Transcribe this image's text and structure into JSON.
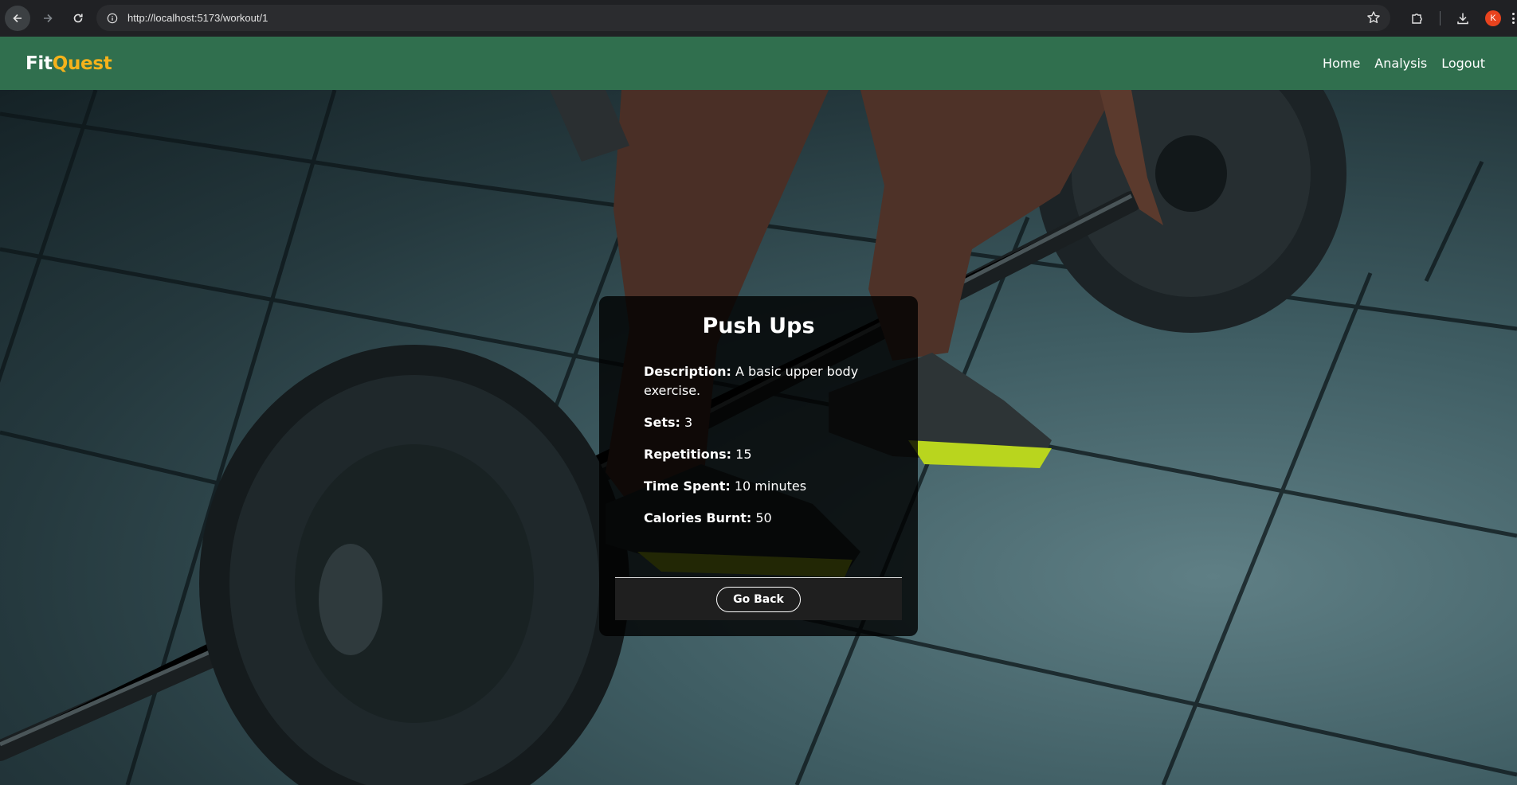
{
  "browser": {
    "url": "http://localhost:5173/workout/1",
    "profile_initial": "K"
  },
  "app": {
    "logo_fit": "Fit",
    "logo_quest": "Quest",
    "nav": [
      "Home",
      "Analysis",
      "Logout"
    ],
    "colors": {
      "header": "#306f4e",
      "accent": "#f5b21b"
    }
  },
  "workout": {
    "title": "Push Ups",
    "description_label": "Description:",
    "description": "A basic upper body exercise.",
    "sets_label": "Sets:",
    "sets": "3",
    "reps_label": "Repetitions:",
    "reps": "15",
    "time_label": "Time Spent:",
    "time": "10 minutes",
    "calories_label": "Calories Burnt:",
    "calories": "50",
    "back_label": "Go Back"
  },
  "icons": [
    "back-arrow-icon",
    "forward-arrow-icon",
    "reload-icon",
    "site-info-icon",
    "star-icon",
    "extensions-icon",
    "download-icon",
    "menu-icon"
  ]
}
